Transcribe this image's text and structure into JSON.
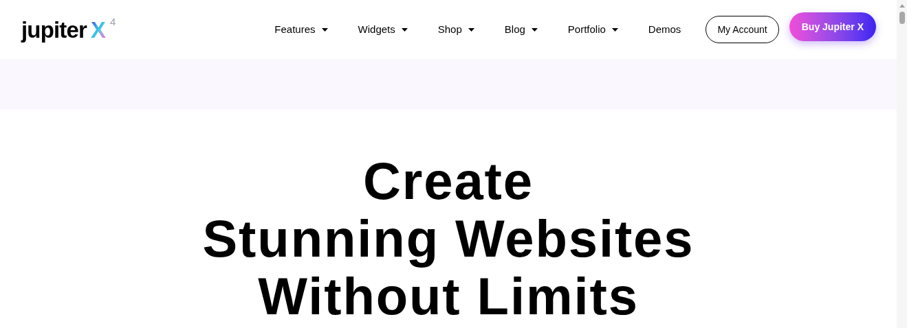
{
  "logo": {
    "word": "jupiter",
    "mark": "X",
    "version": "4"
  },
  "nav": [
    {
      "label": "Features",
      "dropdown": true
    },
    {
      "label": "Widgets",
      "dropdown": true
    },
    {
      "label": "Shop",
      "dropdown": true
    },
    {
      "label": "Blog",
      "dropdown": true
    },
    {
      "label": "Portfolio",
      "dropdown": true
    },
    {
      "label": "Demos",
      "dropdown": false
    }
  ],
  "account_button": "My Account",
  "buy_button": "Buy Jupiter X",
  "hero": {
    "title_lines": [
      "Create",
      "Stunning Websites",
      "Without Limits"
    ]
  }
}
